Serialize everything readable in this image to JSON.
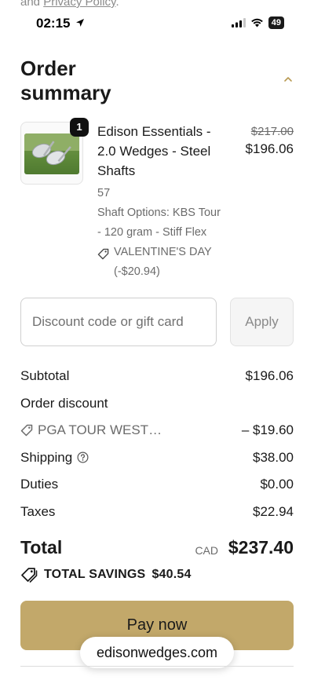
{
  "top_fade": {
    "prefix": "and ",
    "link": "Privacy Policy",
    "suffix": "."
  },
  "status_bar": {
    "time": "02:15",
    "battery": "49"
  },
  "summary": {
    "title": "Order summary"
  },
  "product": {
    "quantity": "1",
    "name": "Edison Essentials - 2.0 Wedges - Steel Shafts",
    "variant": "57",
    "options": "Shaft Options: KBS Tour - 120 gram - Stiff Flex",
    "discount": "VALENTINE'S DAY (-$20.94)",
    "price_original": "$217.00",
    "price_current": "$196.06"
  },
  "discount_field": {
    "placeholder": "Discount code or gift card",
    "value": "",
    "apply_label": "Apply"
  },
  "totals": {
    "subtotal_label": "Subtotal",
    "subtotal_value": "$196.06",
    "order_discount_label": "Order discount",
    "discount_code": "PGA TOUR WEST…",
    "discount_value": "– $19.60",
    "shipping_label": "Shipping",
    "shipping_value": "$38.00",
    "duties_label": "Duties",
    "duties_value": "$0.00",
    "taxes_label": "Taxes",
    "taxes_value": "$22.94"
  },
  "grand_total": {
    "label": "Total",
    "currency": "CAD",
    "value": "$237.40"
  },
  "savings": {
    "label": "TOTAL SAVINGS",
    "value": "$40.54"
  },
  "pay_button": {
    "label": "Pay now"
  },
  "browser": {
    "url": "edisonwedges.com"
  },
  "colors": {
    "pay_button": "#c2a86a",
    "accent_chevron": "#b89a52"
  }
}
